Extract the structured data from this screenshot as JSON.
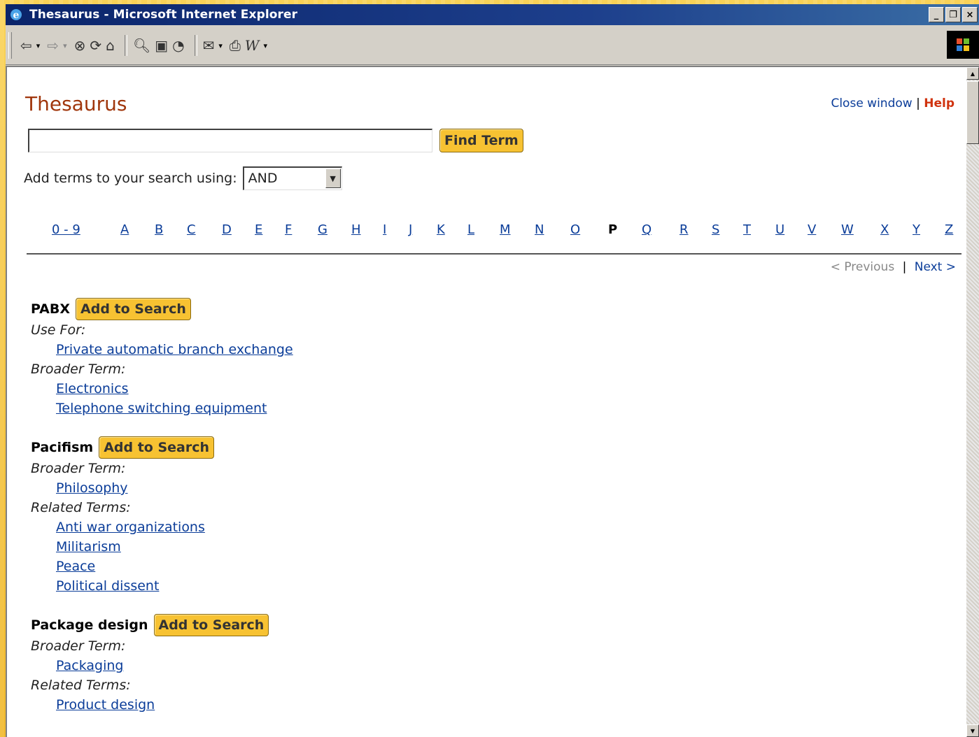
{
  "window": {
    "title": "Thesaurus - Microsoft Internet Explorer"
  },
  "toolbar": {
    "icons": [
      "back-icon",
      "forward-icon",
      "stop-icon",
      "refresh-icon",
      "home-icon",
      "search-icon",
      "favorites-icon",
      "history-icon",
      "mail-icon",
      "print-icon",
      "word-icon"
    ]
  },
  "page": {
    "title": "Thesaurus",
    "close_link": "Close window",
    "separator": "|",
    "help_link": "Help",
    "search": {
      "value": "",
      "button": "Find Term"
    },
    "mode": {
      "label": "Add terms to your search using:",
      "selected": "AND"
    },
    "alphabet": [
      "0 - 9",
      "A",
      "B",
      "C",
      "D",
      "E",
      "F",
      "G",
      "H",
      "I",
      "J",
      "K",
      "L",
      "M",
      "N",
      "O",
      "P",
      "Q",
      "R",
      "S",
      "T",
      "U",
      "V",
      "W",
      "X",
      "Y",
      "Z"
    ],
    "current_letter": "P",
    "pager": {
      "previous": "< Previous",
      "sep": "|",
      "next": "Next >"
    },
    "add_button": "Add to Search",
    "entries": [
      {
        "term": "PABX",
        "groups": [
          {
            "label": "Use For:",
            "links": [
              "Private automatic branch exchange"
            ]
          },
          {
            "label": "Broader Term:",
            "links": [
              "Electronics",
              "Telephone switching equipment"
            ]
          }
        ]
      },
      {
        "term": "Pacifism",
        "groups": [
          {
            "label": "Broader Term:",
            "links": [
              "Philosophy"
            ]
          },
          {
            "label": "Related Terms:",
            "links": [
              "Anti war organizations",
              "Militarism",
              "Peace",
              "Political dissent"
            ]
          }
        ]
      },
      {
        "term": "Package design",
        "groups": [
          {
            "label": "Broader Term:",
            "links": [
              "Packaging"
            ]
          },
          {
            "label": "Related Terms:",
            "links": [
              "Product design"
            ]
          }
        ]
      }
    ]
  }
}
